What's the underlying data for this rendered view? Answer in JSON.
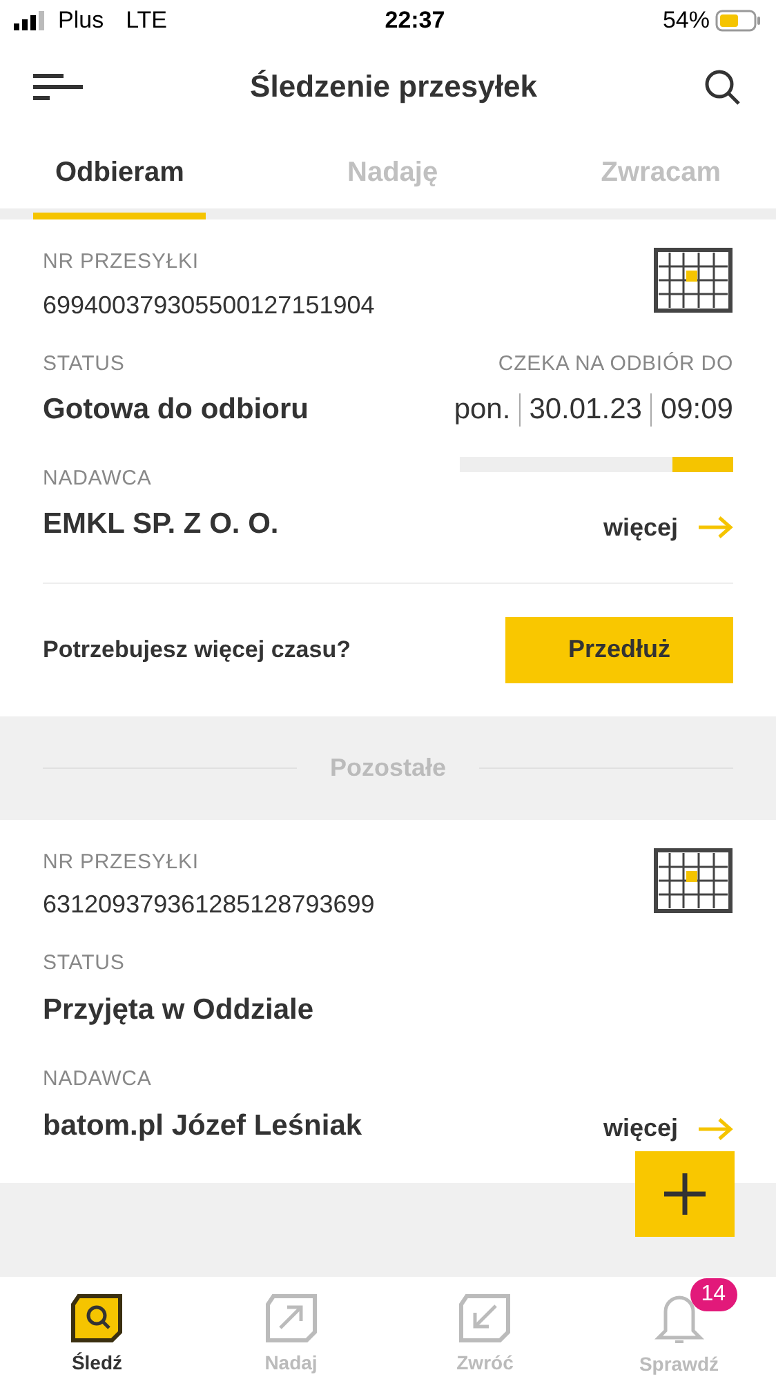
{
  "status_bar": {
    "carrier": "Plus",
    "network": "LTE",
    "time": "22:37",
    "battery": "54%"
  },
  "header": {
    "title": "Śledzenie przesyłek"
  },
  "tabs": [
    {
      "label": "Odbieram",
      "selected": true
    },
    {
      "label": "Nadaję",
      "selected": false
    },
    {
      "label": "Zwracam",
      "selected": false
    }
  ],
  "parcels": [
    {
      "number_label": "NR PRZESYŁKI",
      "number": "699400379305500127151904",
      "status_label": "STATUS",
      "status": "Gotowa do odbioru",
      "deadline_label": "CZEKA NA ODBIÓR DO",
      "deadline_day": "pon.",
      "deadline_date": "30.01.23",
      "deadline_time": "09:09",
      "level": 0.22,
      "sender_label": "NADAWCA",
      "sender": "EMKL SP. Z O. O.",
      "more": "więcej",
      "extend_prompt": "Potrzebujesz więcej czasu?",
      "extend_button": "Przedłuż"
    }
  ],
  "section_title": "Pozostałe",
  "other_parcels": [
    {
      "number_label": "NR PRZESYŁKI",
      "number": "631209379361285128793699",
      "status_label": "STATUS",
      "status": "Przyjęta w Oddziale",
      "sender_label": "NADAWCA",
      "sender": "batom.pl Józef Leśniak",
      "more": "więcej"
    }
  ],
  "bottom_nav": [
    {
      "label": "Śledź",
      "selected": true
    },
    {
      "label": "Nadaj",
      "selected": false
    },
    {
      "label": "Zwróć",
      "selected": false
    },
    {
      "label": "Sprawdź",
      "selected": false,
      "badge": "14"
    }
  ]
}
